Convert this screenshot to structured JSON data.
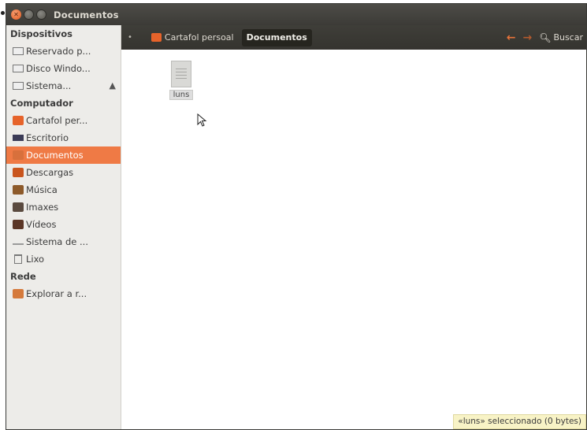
{
  "window": {
    "title": "Documentos"
  },
  "sidebar": {
    "sections": [
      {
        "heading": "Dispositivos",
        "items": [
          {
            "label": "Reservado p...",
            "icon": "drive-icon"
          },
          {
            "label": "Disco Windo...",
            "icon": "drive-icon"
          },
          {
            "label": "Sistema...",
            "icon": "drive-icon",
            "eject": "▲"
          }
        ]
      },
      {
        "heading": "Computador",
        "items": [
          {
            "label": "Cartafol per...",
            "icon": "home-folder-icon"
          },
          {
            "label": "Escritorio",
            "icon": "desktop-icon"
          },
          {
            "label": "Documentos",
            "icon": "documents-folder-icon",
            "selected": true
          },
          {
            "label": "Descargas",
            "icon": "downloads-folder-icon"
          },
          {
            "label": "Música",
            "icon": "music-folder-icon"
          },
          {
            "label": "Imaxes",
            "icon": "pictures-folder-icon"
          },
          {
            "label": "Vídeos",
            "icon": "videos-folder-icon"
          },
          {
            "label": "Sistema de ...",
            "icon": "filesystem-icon"
          },
          {
            "label": "Lixo",
            "icon": "trash-icon"
          }
        ]
      },
      {
        "heading": "Rede",
        "items": [
          {
            "label": "Explorar a r...",
            "icon": "network-icon"
          }
        ]
      }
    ]
  },
  "toolbar": {
    "path": [
      "Cartafol persoal",
      "Documentos"
    ],
    "back": "←",
    "forward": "→",
    "search_label": "Buscar"
  },
  "files": [
    {
      "name": "luns",
      "icon": "text-document-icon"
    }
  ],
  "status": "«luns» seleccionado (0 bytes)",
  "colors": {
    "accent": "#ef7a45",
    "titlebar": "#3c3b37",
    "sidebar": "#edece9",
    "status_bg": "#f8f3c6"
  }
}
